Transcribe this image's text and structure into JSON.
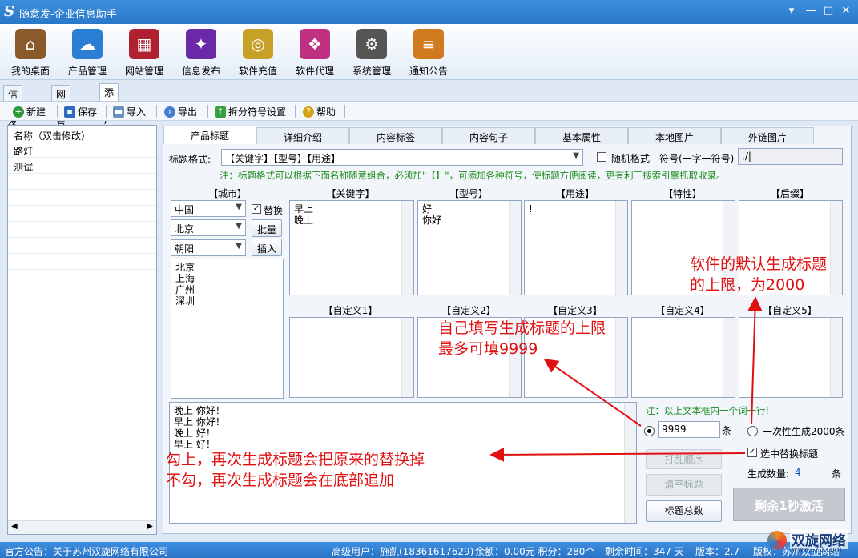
{
  "window": {
    "logo": "S",
    "title": "随意发-企业信息助手"
  },
  "toolbar": [
    {
      "label": "我的桌面",
      "icon": "house-icon",
      "color": "#8a5a2b"
    },
    {
      "label": "产品管理",
      "icon": "cloud-icon",
      "color": "#2a7fd4"
    },
    {
      "label": "网站管理",
      "icon": "film-icon",
      "color": "#b02030"
    },
    {
      "label": "信息发布",
      "icon": "wand-icon",
      "color": "#6a2aa8"
    },
    {
      "label": "软件充值",
      "icon": "coins-icon",
      "color": "#c7a028"
    },
    {
      "label": "软件代理",
      "icon": "gift-icon",
      "color": "#c03080"
    },
    {
      "label": "系统管理",
      "icon": "gear-icon",
      "color": "#555555"
    },
    {
      "label": "通知公告",
      "icon": "notes-icon",
      "color": "#d07a20"
    }
  ],
  "top_tabs": [
    "信息发布",
    "网站管理",
    "添加产品"
  ],
  "subbar": {
    "new": "新建",
    "save": "保存",
    "import": "导入",
    "export": "导出",
    "split": "拆分符号设置",
    "help": "帮助"
  },
  "left_list": {
    "header": "名称（双击修改）",
    "items": [
      "路灯",
      "测试"
    ]
  },
  "product_tabs": [
    "产品标题",
    "详细介绍",
    "内容标签",
    "内容句子",
    "基本属性",
    "本地图片",
    "外链图片"
  ],
  "format": {
    "label": "标题格式:",
    "value": "【关键字】【型号】【用途】",
    "random": "随机格式",
    "symbol_label": "符号(一字一符号)",
    "symbol_value": ",/|"
  },
  "note_top": "注：标题格式可以根据下面名称随意组合，必须加\"【】\"，可添加各种符号，使标题方便阅读，更有利于搜索引擎抓取收录。",
  "city": {
    "header": "【城市】",
    "province": "中国",
    "city": "北京",
    "district": "朝阳",
    "replace": "替换",
    "batch": "批量",
    "insert": "插入",
    "list": "北京\n上海\n广州\n深圳"
  },
  "columns": [
    {
      "header": "【关键字】",
      "content": "早上\n晚上"
    },
    {
      "header": "【型号】",
      "content": "好\n你好"
    },
    {
      "header": "【用途】",
      "content": "!"
    },
    {
      "header": "【特性】",
      "content": ""
    },
    {
      "header": "【后缀】",
      "content": ""
    }
  ],
  "custom_columns": [
    "【自定义1】",
    "【自定义2】",
    "【自定义3】",
    "【自定义4】",
    "【自定义5】"
  ],
  "output": "晚上 你好！\n早上 你好！\n晚上 好！\n早上 好！",
  "note_line": "注：以上文本框内一个词一行!",
  "limit": {
    "value": "9999",
    "unit": "条",
    "once": "一次性生成2000条"
  },
  "replace_selected": "选中替换标题",
  "shuffle": "打乱顺序",
  "clear": "清空标题",
  "count_label": "生成数量:",
  "count_value": "4",
  "count_unit": "条",
  "total": "标题总数",
  "activate": "剩余1秒激活",
  "annotations": {
    "a1": "软件的默认生成标题",
    "a2": "的上限，为2000",
    "b1": "自己填写生成标题的上限",
    "b2": "最多可填9999",
    "c1": "勾上，再次生成标题会把原来的替换掉",
    "c2": "不勾，再次生成标题会在底部追加"
  },
  "status": {
    "notice": "官方公告：关于苏州双旋网络有限公司",
    "user": "高级用户：施凯(18361617629)",
    "balance": "余额：0.00元 积分：280个",
    "remain": "剩余时间：347 天",
    "version": "版本：2.7",
    "copyright": "版权：苏州双旋网络",
    "watermark": "双旋网络",
    "watermark_url": "www.s70.com"
  }
}
